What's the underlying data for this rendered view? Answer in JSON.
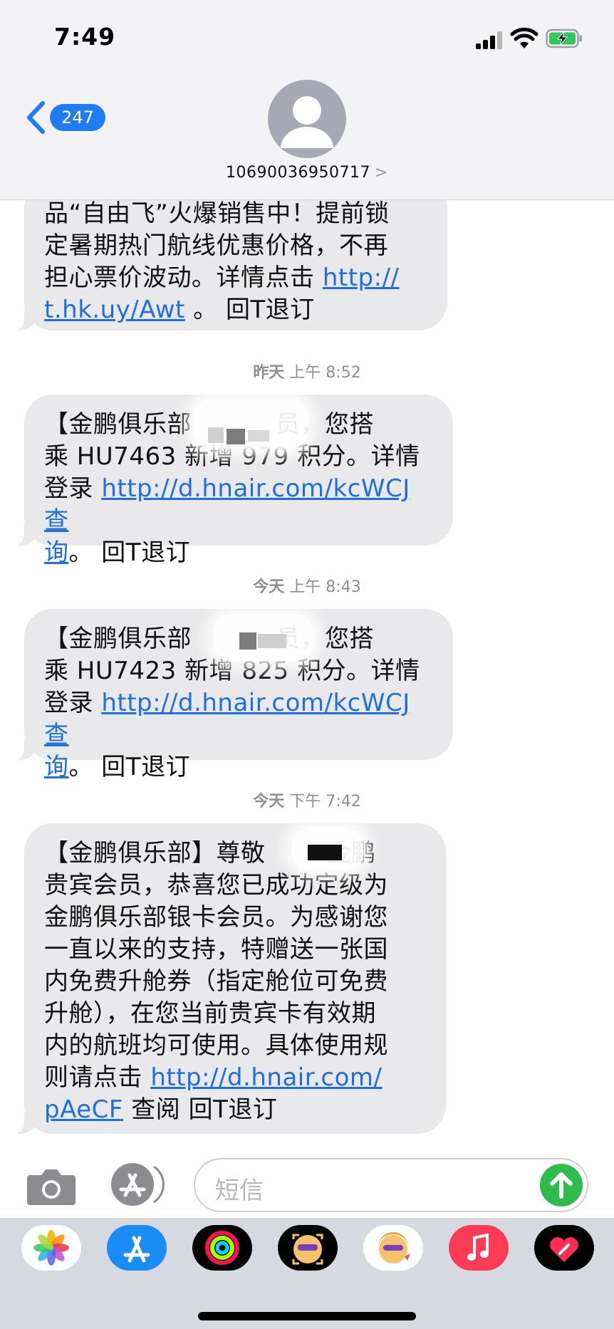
{
  "status": {
    "time": "7:49"
  },
  "header": {
    "back_count": "247",
    "contact_number": "10690036950717",
    "contact_chevron": ">"
  },
  "messages": [
    {
      "lines": [
        "品“自由飞”火爆销售中！提前锁",
        "定暑期热门航线优惠价格，不再",
        "担心票价波动。详情点击 "
      ],
      "link": "http://t.hk.uy/Awt",
      "link_line3": "http://",
      "link_line4": "t.hk.uy/Awt",
      "tail_text": " 。 回T退订"
    },
    {
      "timestamp_day": "昨天",
      "timestamp_time": "上午 8:52",
      "line1": "【金鹏俱乐部",
      "line1_end": "员，您搭",
      "line2": "乘 HU7463 新增 979 积分。详情",
      "line3_pre": "登录 ",
      "link": "http://d.hnair.com/kcWCJ",
      "line3_post": " 查",
      "line4_link": "询",
      "line4_post": "。 回T退订"
    },
    {
      "timestamp_day": "今天",
      "timestamp_time": "上午 8:43",
      "line1": "【金鹏俱乐部",
      "line1_end": "员，您搭",
      "line2": "乘 HU7423 新增 825 积分。详情",
      "line3_pre": "登录 ",
      "link": "http://d.hnair.com/kcWCJ",
      "line3_post": " 查",
      "line4_link": "询",
      "line4_post": "。 回T退订"
    },
    {
      "timestamp_day": "今天",
      "timestamp_time": "下午 7:42",
      "line1": "【金鹏俱乐部】尊敬",
      "line1_end": "金鹏",
      "lines": [
        "贵宾会员，恭喜您已成功定级为",
        "金鹏俱乐部银卡会员。为感谢您",
        "一直以来的支持，特赠送一张国",
        "内免费升舱券（指定舱位可免费",
        "升舱），在您当前贵宾卡有效期",
        "内的航班均可使用。具体使用规"
      ],
      "line8_pre": "则请点击 ",
      "link_a": "http://d.hnair.com/",
      "link_b": "pAeCF",
      "line9_post": " 查阅 回T退订"
    }
  ],
  "compose": {
    "placeholder": "短信"
  },
  "drawer": {
    "apps": [
      "photos-icon",
      "app-store-icon",
      "activity-icon",
      "memoji-icon",
      "memoji-sticker-icon",
      "music-icon",
      "heart-digital-touch-icon"
    ]
  },
  "colors": {
    "link": "#1f6fe0",
    "bubble": "#e9e9eb",
    "badge": "#1f7cf4",
    "send": "#2fbc4d"
  }
}
